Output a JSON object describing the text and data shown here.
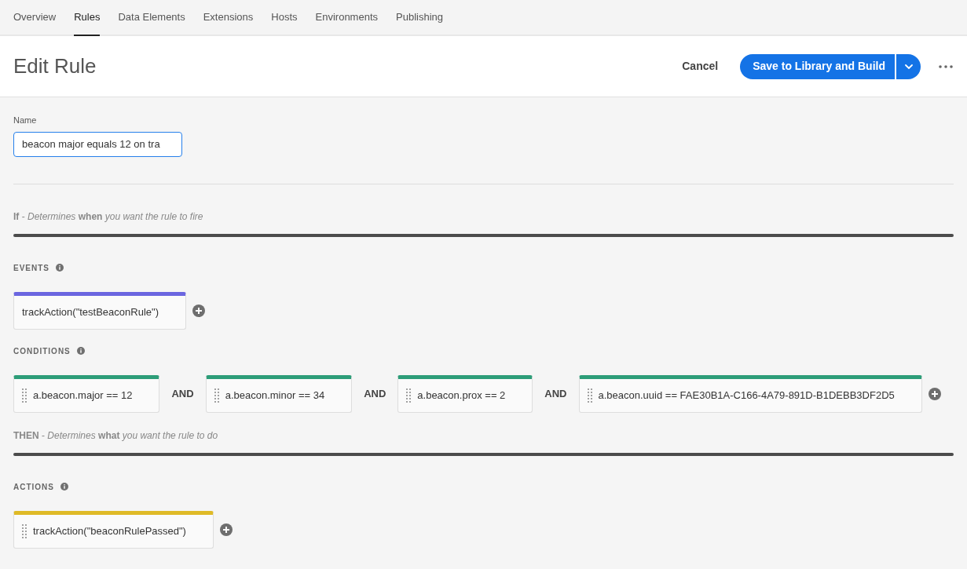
{
  "tabs": [
    {
      "label": "Overview",
      "selected": false
    },
    {
      "label": "Rules",
      "selected": true
    },
    {
      "label": "Data Elements",
      "selected": false
    },
    {
      "label": "Extensions",
      "selected": false
    },
    {
      "label": "Hosts",
      "selected": false
    },
    {
      "label": "Environments",
      "selected": false
    },
    {
      "label": "Publishing",
      "selected": false
    }
  ],
  "header": {
    "title": "Edit Rule",
    "cancel": "Cancel",
    "save": "Save to Library and Build"
  },
  "name_field": {
    "label": "Name",
    "value": "beacon major equals 12 on tra"
  },
  "sections": [
    {
      "heading": "**If** - *Determines* **when** *you want the rule to fire*",
      "groups": [
        {
          "label": "EVENTS",
          "color": "#6b66e0",
          "items": [
            {
              "text": "trackAction(\"testBeaconRule\")",
              "draggable": false
            }
          ]
        },
        {
          "label": "CONDITIONS",
          "color": "#2d9d78",
          "items": [
            {
              "text": "a.beacon.major == 12",
              "draggable": true
            },
            {
              "connector": "AND",
              "text": "a.beacon.minor == 34",
              "draggable": true
            },
            {
              "connector": "AND",
              "text": "a.beacon.prox == 2",
              "draggable": true
            },
            {
              "connector": "AND",
              "text": "a.beacon.uuid == FAE30B1A-C166-4A79-891D-B1DEBB3DF2D5",
              "draggable": true
            }
          ]
        }
      ]
    },
    {
      "heading": "**THEN** - *Determines* **what** *you want the rule to do*",
      "groups": [
        {
          "label": "ACTIONS",
          "color": "#dfba27",
          "items": [
            {
              "text": "trackAction(\"beaconRulePassed\")",
              "draggable": true
            }
          ]
        }
      ]
    }
  ]
}
